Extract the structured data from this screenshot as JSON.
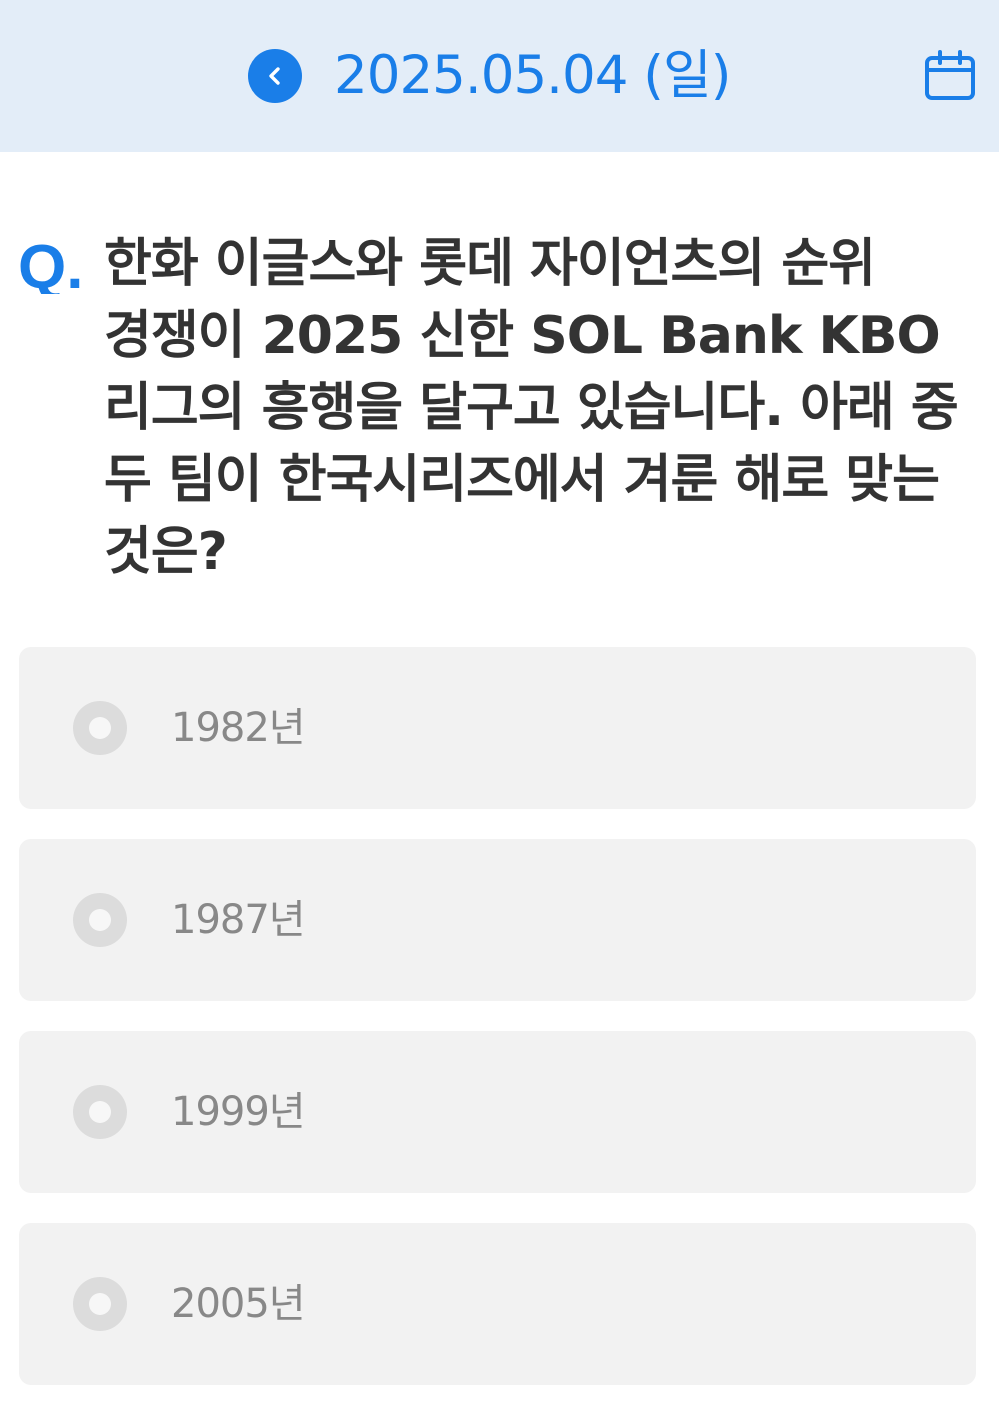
{
  "header": {
    "date": "2025.05.04 (일)",
    "back_icon": "chevron-left-icon",
    "calendar_icon": "calendar-icon",
    "accent_color": "#1a7ee8",
    "background_color": "#e3edf8"
  },
  "quiz": {
    "q_prefix": "Q.",
    "question": "한화 이글스와 롯데 자이언츠의 순위 경쟁이 2025 신한 SOL Bank KBO 리그의 흥행을 달구고 있습니다. 아래 중 두 팀이 한국시리즈에서 겨룬 해로 맞는 것은?",
    "options": [
      {
        "label": "1982년",
        "selected": false
      },
      {
        "label": "1987년",
        "selected": false
      },
      {
        "label": "1999년",
        "selected": false
      },
      {
        "label": "2005년",
        "selected": false
      }
    ]
  }
}
